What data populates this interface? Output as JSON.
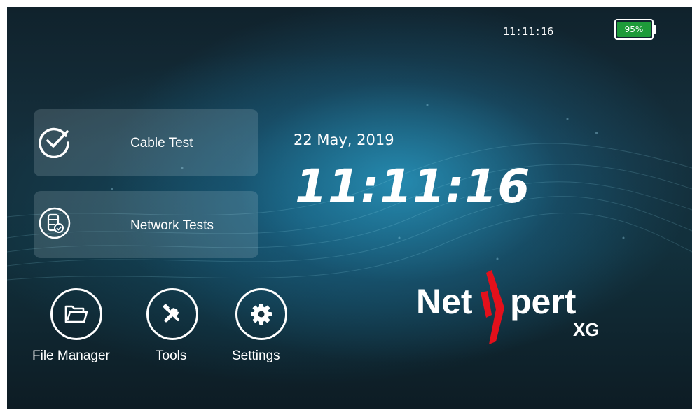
{
  "status_bar": {
    "time": "11:11:16",
    "battery_level": "95%",
    "battery_color": "#1e9b3a"
  },
  "tiles": [
    {
      "label": "Cable Test",
      "icon": "check-circle-icon"
    },
    {
      "label": "Network Tests",
      "icon": "server-check-icon"
    }
  ],
  "main": {
    "date": "22 May, 2019",
    "clock": "11:11:16"
  },
  "shortcuts": [
    {
      "label": "File Manager",
      "icon": "folder-icon"
    },
    {
      "label": "Tools",
      "icon": "tools-icon"
    },
    {
      "label": "Settings",
      "icon": "gear-icon"
    }
  ],
  "logo": {
    "text_before": "Net",
    "text_after": "pert",
    "sub": "XG",
    "accent_color": "#e3101b"
  }
}
